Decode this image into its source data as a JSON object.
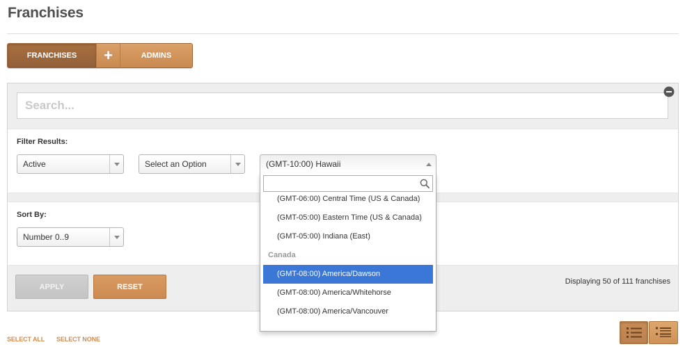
{
  "page": {
    "title": "Franchises"
  },
  "tabs": {
    "franchises": "FRANCHISES",
    "add": "+",
    "admins": "ADMINS",
    "franchises_active": true
  },
  "search": {
    "placeholder": "Search..."
  },
  "panel": {
    "collapse_icon": "minus-circle-icon"
  },
  "filters": {
    "label": "Filter Results:",
    "status": {
      "value": "Active",
      "icon": "chevron-down-icon"
    },
    "option": {
      "value": "Select an Option",
      "icon": "chevron-down-icon"
    },
    "timezone": {
      "value": "(GMT-10:00) Hawaii",
      "open": true,
      "icon": "chevron-up-icon"
    }
  },
  "timezone_dropdown": {
    "search_icon": "search-icon",
    "options": [
      {
        "label": "(GMT-06:00) Central Time (US & Canada)"
      },
      {
        "label": "(GMT-05:00) Eastern Time (US & Canada)"
      },
      {
        "label": "(GMT-05:00) Indiana (East)"
      },
      {
        "group": "Canada"
      },
      {
        "label": "(GMT-08:00) America/Dawson",
        "highlighted": true
      },
      {
        "label": "(GMT-08:00) America/Whitehorse"
      },
      {
        "label": "(GMT-08:00) America/Vancouver"
      }
    ]
  },
  "sort": {
    "label": "Sort By:",
    "value": "Number 0..9",
    "icon": "chevron-down-icon"
  },
  "actions": {
    "apply": "APPLY",
    "apply_disabled": true,
    "reset": "RESET",
    "count_text": "Displaying 50 of 111 franchises"
  },
  "selection": {
    "select_all": "SELECT ALL",
    "select_none": "SELECT NONE"
  },
  "view_toggle": {
    "compact_icon": "list-view-icon",
    "detail_icon": "detail-list-view-icon",
    "compact_active": true
  },
  "colors": {
    "accent": "#d08f57",
    "accent_dark": "#a56b3e",
    "highlight": "#3b77d7",
    "link": "#d38b4f",
    "disabled": "#c8c8c8",
    "title": "#4f4f4f"
  }
}
